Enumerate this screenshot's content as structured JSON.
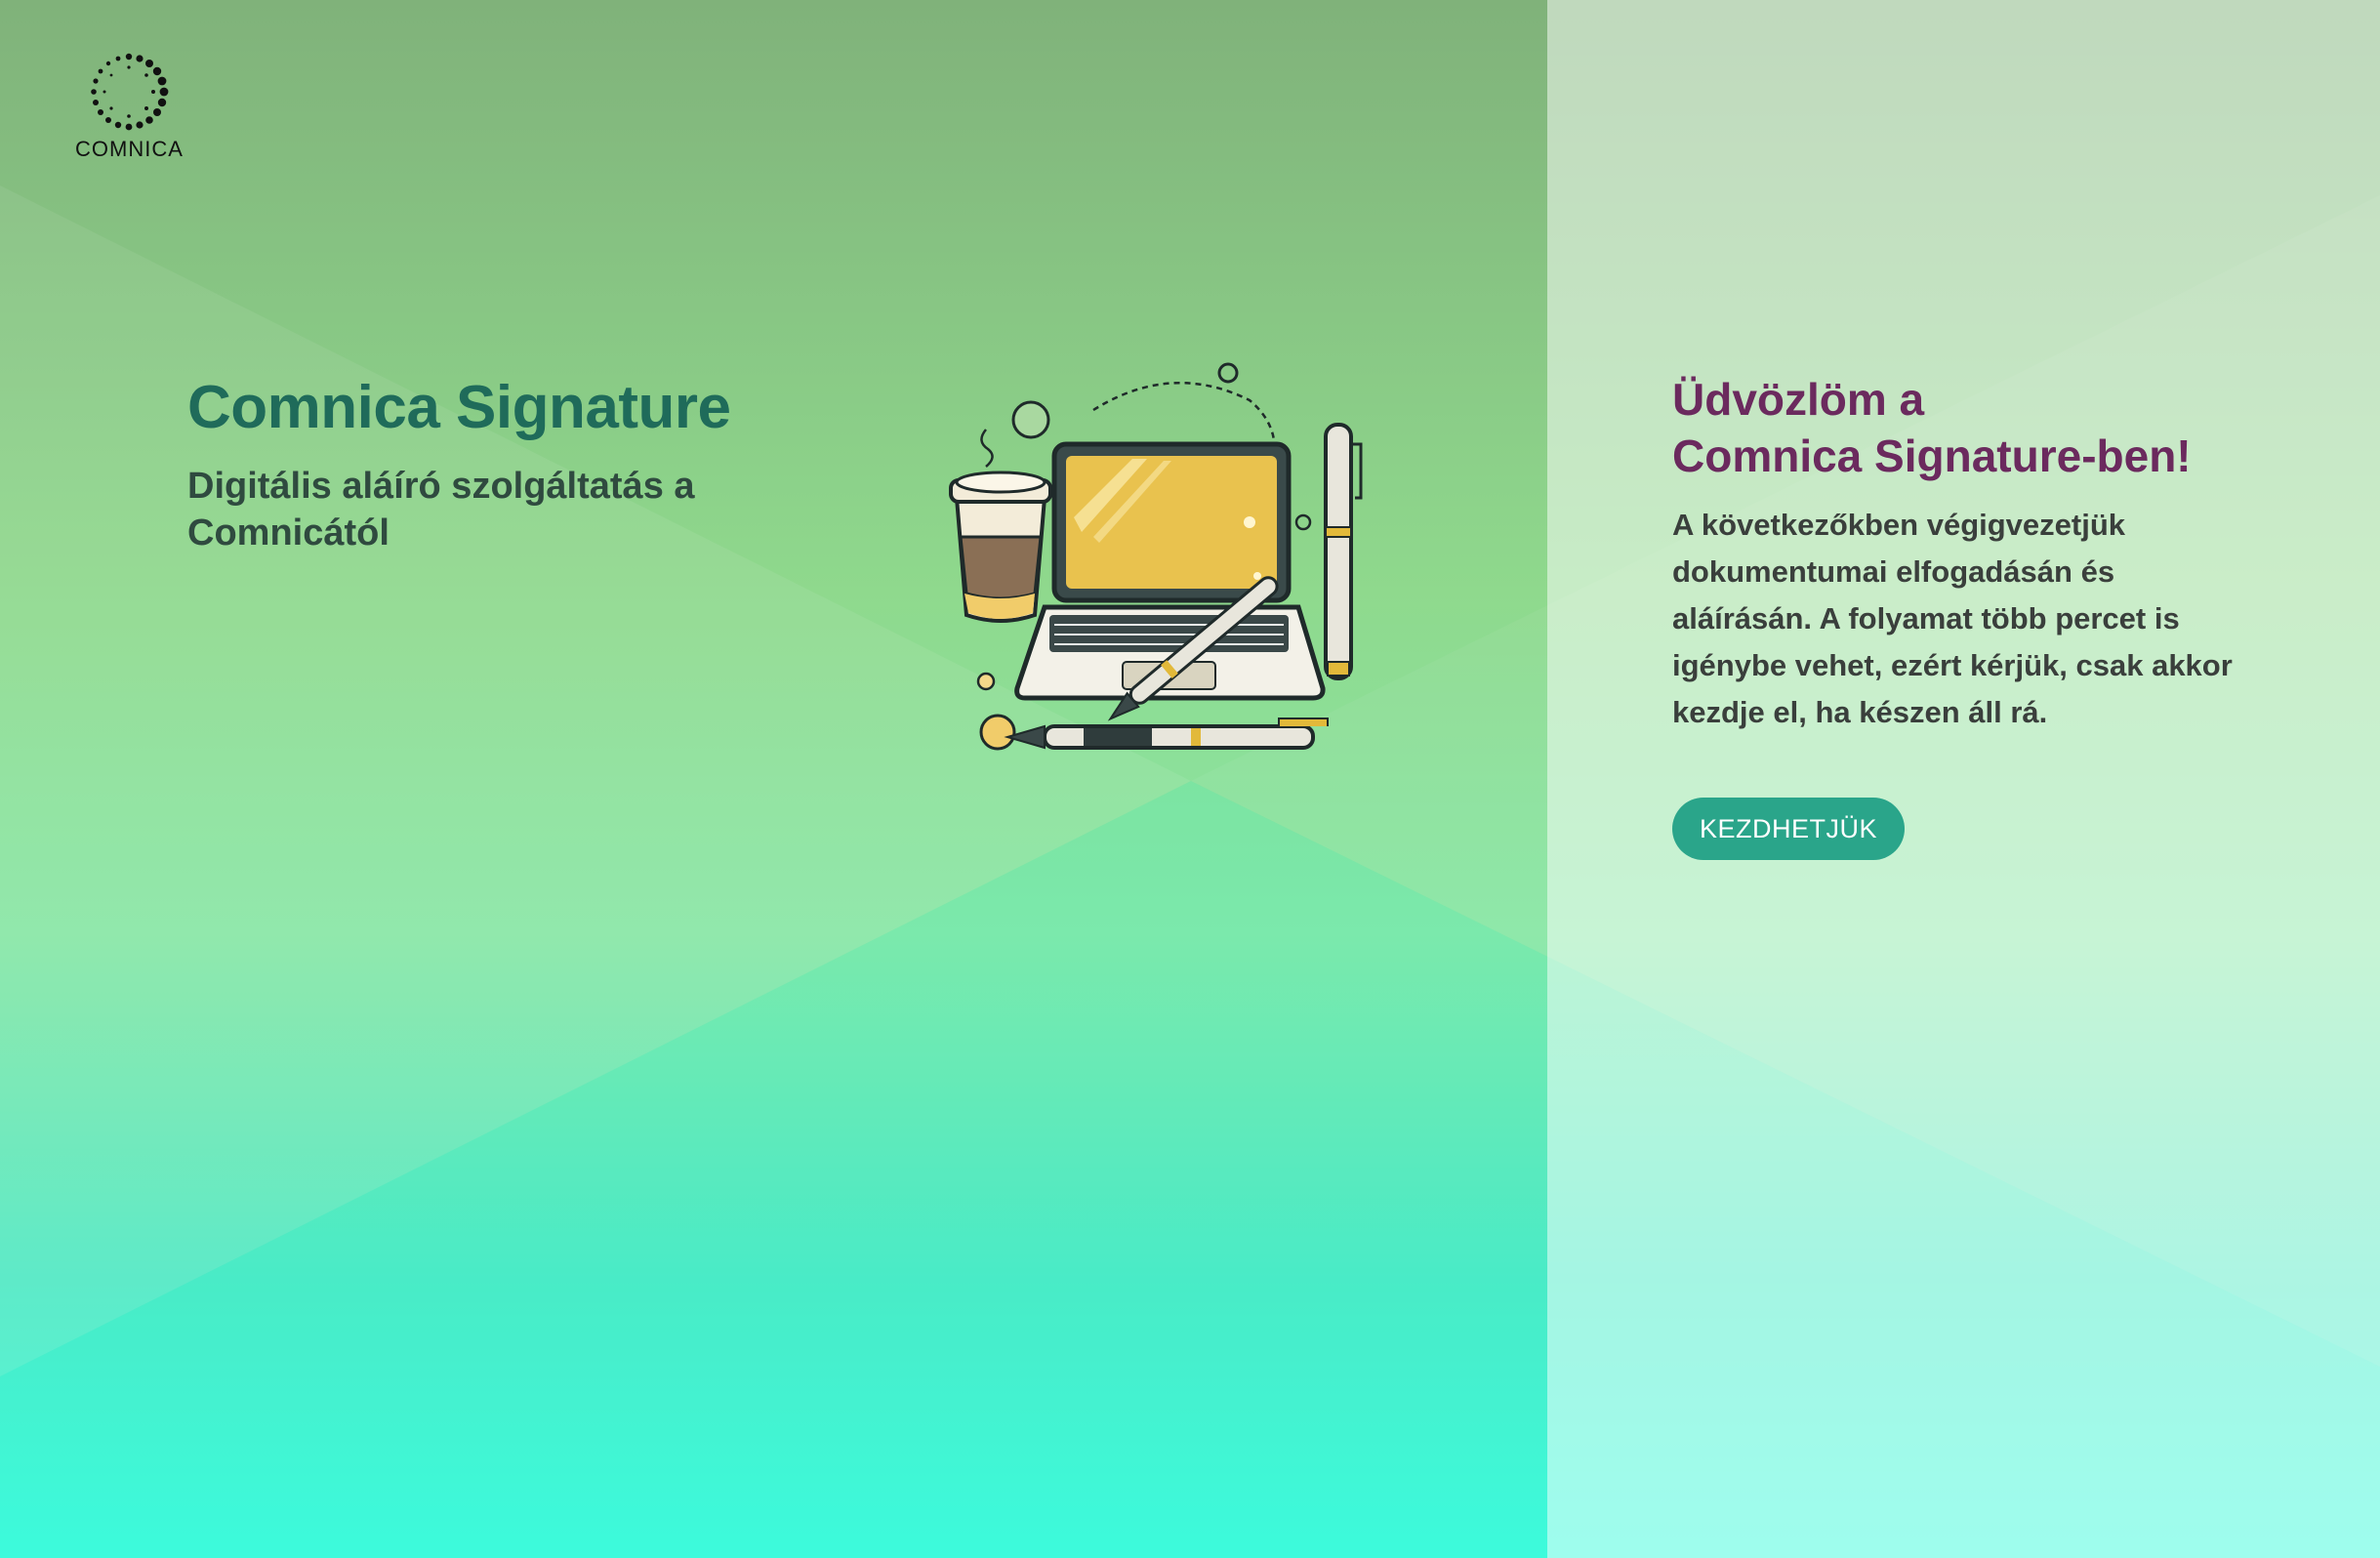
{
  "brand": {
    "logo_text": "COMNICA"
  },
  "hero": {
    "title": "Comnica Signature",
    "subtitle": "Digitális aláíró szolgáltatás a Comnicától"
  },
  "welcome": {
    "heading_line1": "Üdvözlöm a",
    "heading_line2": "Comnica Signature-ben!",
    "body": "A következőkben végigvezetjük dokumentumai elfogadásán és aláírásán. A folyamat több percet is igénybe vehet, ezért kérjük, csak akkor kezdje el, ha készen áll rá."
  },
  "actions": {
    "start_label": "KEZDHETJÜK"
  },
  "colors": {
    "title": "#1f6b5a",
    "heading": "#6b2a5e",
    "button": "#2aa58a"
  },
  "icons": {
    "logo": "dotted-ring-logo-icon",
    "illustration": "laptop-coffee-pen-illustration"
  }
}
